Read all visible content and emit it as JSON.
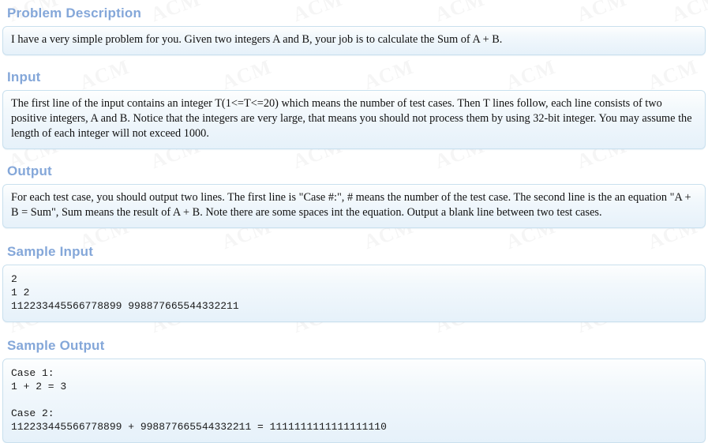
{
  "watermark": {
    "text": "ACM",
    "color": "#000000"
  },
  "theme": {
    "heading_color": "#84a7d9",
    "panel_border_color": "#c9e0ee",
    "panel_bg_top": "#fdfefe",
    "panel_bg_bottom": "#e6f1fa",
    "body_text_color": "#111111",
    "page_bg": "#ffffff"
  },
  "sections": {
    "problem_description": {
      "title": "Problem Description",
      "body": "I have a very simple problem for you. Given two integers A and B, your job is to calculate the Sum of A + B."
    },
    "input": {
      "title": "Input",
      "body": "The first line of the input contains an integer T(1<=T<=20) which means the number of test cases. Then T lines follow, each line consists of two positive integers, A and B. Notice that the integers are very large, that means you should not process them by using 32-bit integer. You may assume the length of each integer will not exceed 1000."
    },
    "output": {
      "title": "Output",
      "body": "For each test case, you should output two lines. The first line is \"Case #:\", # means the number of the test case. The second line is the an equation \"A + B = Sum\", Sum means the result of A + B. Note there are some spaces int the equation. Output a blank line between two test cases."
    },
    "sample_input": {
      "title": "Sample Input",
      "body": "2\n1 2\n112233445566778899 998877665544332211"
    },
    "sample_output": {
      "title": "Sample Output",
      "body": "Case 1:\n1 + 2 = 3\n\nCase 2:\n112233445566778899 + 998877665544332211 = 1111111111111111110"
    }
  }
}
